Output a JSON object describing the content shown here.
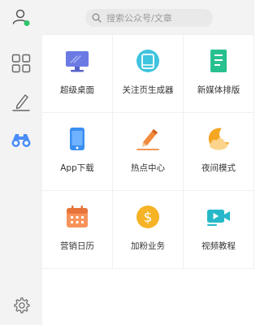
{
  "search": {
    "placeholder": "搜索公众号/文章"
  },
  "sidebar": {
    "items": [
      {
        "icon": "user-icon"
      },
      {
        "icon": "grid-icon"
      },
      {
        "icon": "pen-icon"
      },
      {
        "icon": "binoculars-icon"
      },
      {
        "icon": "gear-icon"
      }
    ],
    "status_color": "#2ec46b",
    "active_color": "#4a8df6"
  },
  "tools": [
    {
      "label": "超级桌面",
      "icon": "monitor-icon"
    },
    {
      "label": "关注页生成器",
      "icon": "tablet-icon"
    },
    {
      "label": "新媒体排版",
      "icon": "document-icon"
    },
    {
      "label": "App下载",
      "icon": "phone-icon"
    },
    {
      "label": "热点中心",
      "icon": "pencil-icon"
    },
    {
      "label": "夜间模式",
      "icon": "moon-icon"
    },
    {
      "label": "营销日历",
      "icon": "calendar-icon"
    },
    {
      "label": "加粉业务",
      "icon": "coin-icon"
    },
    {
      "label": "视频教程",
      "icon": "video-icon"
    }
  ]
}
